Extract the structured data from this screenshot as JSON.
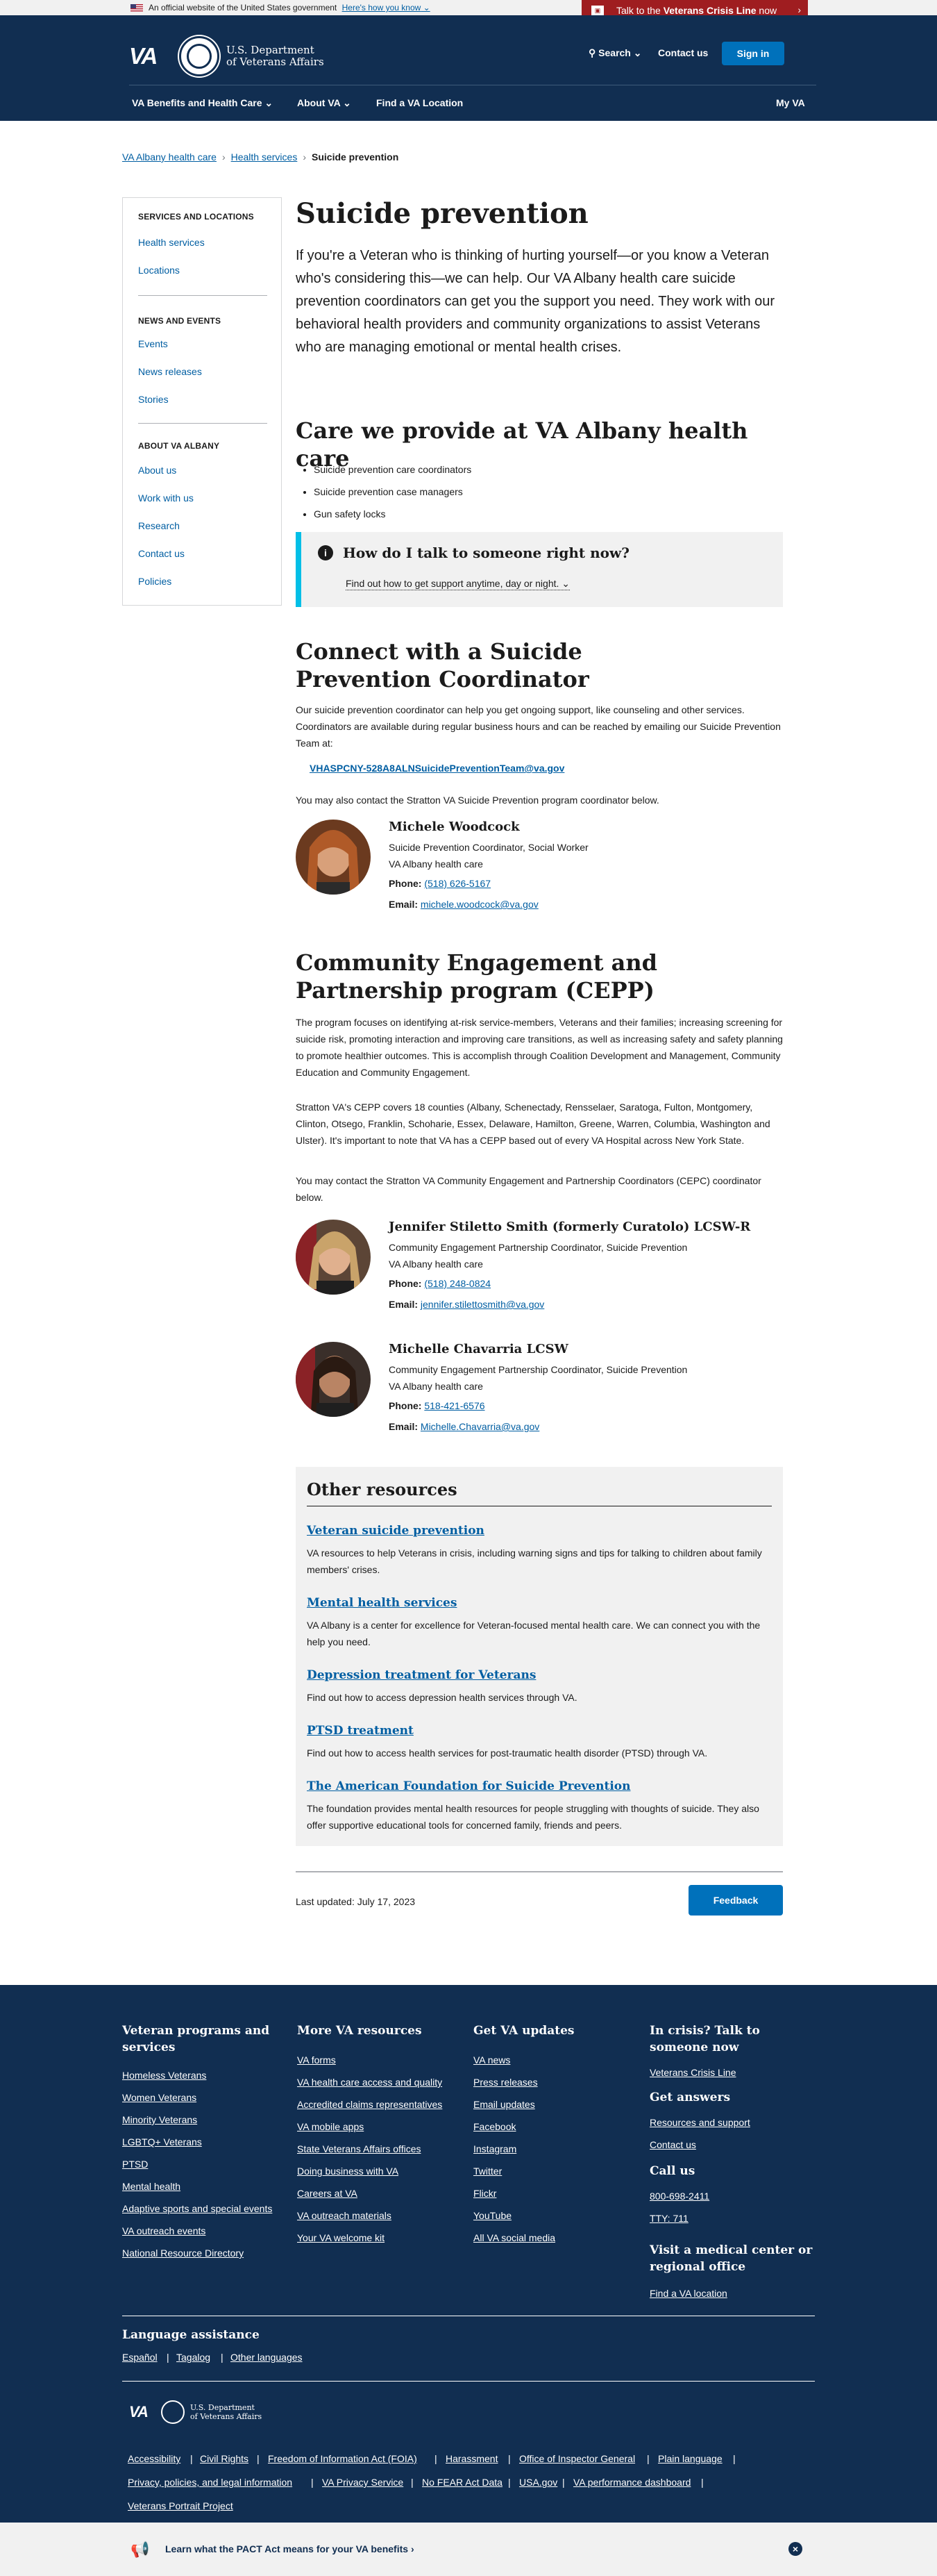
{
  "gov_banner": {
    "text": "An official website of the United States government",
    "link": "Here's how you know"
  },
  "crisis_line": {
    "prefix": "Talk to the ",
    "bold": "Veterans Crisis Line",
    "suffix": " now"
  },
  "header": {
    "logo_va": "VA",
    "logo_line1": "U.S. Department",
    "logo_line2": "of Veterans Affairs",
    "search": "Search",
    "contact": "Contact us",
    "signin": "Sign in",
    "nav": [
      "VA Benefits and Health Care",
      "About VA",
      "Find a VA Location"
    ],
    "myva": "My VA"
  },
  "breadcrumbs": [
    "VA Albany health care",
    "Health services",
    "Suicide prevention"
  ],
  "sidenav": {
    "sections": [
      {
        "title": "SERVICES AND LOCATIONS",
        "links": [
          "Health services",
          "Locations"
        ]
      },
      {
        "title": "NEWS AND EVENTS",
        "links": [
          "Events",
          "News releases",
          "Stories"
        ]
      },
      {
        "title": "ABOUT VA ALBANY",
        "links": [
          "About us",
          "Work with us",
          "Research",
          "Contact us",
          "Policies"
        ]
      }
    ]
  },
  "main": {
    "title": "Suicide prevention",
    "intro": "If you're a Veteran who is thinking of hurting yourself—or you know a Veteran who's considering this—we can help. Our VA Albany health care suicide prevention coordinators can get you the support you need. They work with our behavioral health providers and community organizations to assist Veterans who are managing emotional or mental health crises.",
    "care_heading": "Care we provide at VA Albany health care",
    "care_items": [
      "Suicide prevention care coordinators",
      "Suicide prevention case managers",
      "Gun safety locks"
    ],
    "alert_heading": "How do I talk to someone right now?",
    "alert_link": "Find out how to get support anytime, day or night.",
    "coord_heading": "Connect with a Suicide Prevention Coordinator",
    "coord_text": "Our suicide prevention coordinator can help you get ongoing support, like counseling and other services. Coordinators are available during regular business hours and can be reached by emailing our Suicide Prevention Team at:",
    "team_email": "VHASPCNY-528A8ALNSuicidePreventionTeam@va.gov",
    "contact_text": "You may also contact the Stratton VA Suicide Prevention program coordinator below.",
    "people": [
      {
        "name": "Michele Woodcock",
        "role": "Suicide Prevention Coordinator, Social Worker",
        "org": "VA Albany health care",
        "phone_label": "Phone:",
        "phone": "(518) 626-5167",
        "email_label": "Email:",
        "email": "michele.woodcock@va.gov"
      },
      {
        "name": "Jennifer Stiletto Smith (formerly Curatolo) LCSW-R",
        "role": "Community Engagement Partnership Coordinator, Suicide Prevention",
        "org": "VA Albany health care",
        "phone_label": "Phone:",
        "phone": "(518) 248-0824",
        "email_label": "Email:",
        "email": "jennifer.stilettosmith@va.gov"
      },
      {
        "name": "Michelle Chavarria LCSW",
        "role": "Community Engagement Partnership Coordinator, Suicide Prevention",
        "org": "VA Albany health care",
        "phone_label": "Phone:",
        "phone": "518-421-6576",
        "email_label": "Email:",
        "email": "Michelle.Chavarria@va.gov"
      }
    ],
    "cepp_heading": "Community Engagement and Partnership program (CEPP)",
    "cepp_p1": "The program focuses on identifying at-risk service-members, Veterans and their families; increasing screening for suicide risk, promoting interaction and improving care transitions, as well as increasing safety and safety planning to promote healthier outcomes.  This is accomplish through Coalition Development and Management, Community Education and Community Engagement.",
    "cepp_p2": "Stratton VA's CEPP  covers 18 counties (Albany, Schenectady, Rensselaer, Saratoga, Fulton, Montgomery, Clinton, Otsego, Franklin, Schoharie, Essex, Delaware, Hamilton, Greene, Warren, Columbia, Washington and Ulster).  It's important to note that VA has a CEPP based out of every VA Hospital across New York State.",
    "cepp_p3": "You may contact the Stratton VA Community Engagement and Partnership Coordinators (CEPC) coordinator below.",
    "resources_heading": "Other resources",
    "resources": [
      {
        "title": "Veteran suicide prevention",
        "desc": "VA resources to help Veterans in crisis, including warning signs and tips for talking to children about family members' crises."
      },
      {
        "title": "Mental health services",
        "desc": "VA Albany is a center for excellence for Veteran-focused mental health care. We can connect you with the help you need."
      },
      {
        "title": "Depression treatment for Veterans",
        "desc": "Find out how to access depression health services through VA."
      },
      {
        "title": "PTSD treatment",
        "desc": "Find out how to access health services for post-traumatic health disorder (PTSD) through VA."
      },
      {
        "title": "The American Foundation for Suicide Prevention",
        "desc": "The foundation provides mental health resources for people struggling with thoughts of suicide. They also offer supportive educational tools for concerned family, friends and peers."
      }
    ],
    "last_updated": "Last updated: July 17, 2023",
    "feedback": "Feedback"
  },
  "footer": {
    "col1_heading": "Veteran programs and services",
    "col1_links": [
      "Homeless Veterans",
      "Women Veterans",
      "Minority Veterans",
      "LGBTQ+ Veterans",
      "PTSD",
      "Mental health",
      "Adaptive sports and special events",
      "VA outreach events",
      "National Resource Directory"
    ],
    "col2_heading": "More VA resources",
    "col2_links": [
      "VA forms",
      "VA health care access and quality",
      "Accredited claims representatives",
      "VA mobile apps",
      "State Veterans Affairs offices",
      "Doing business with VA",
      "Careers at VA",
      "VA outreach materials",
      "Your VA welcome kit"
    ],
    "col3_heading": "Get VA updates",
    "col3_links": [
      "VA news",
      "Press releases",
      "Email updates",
      "Facebook",
      "Instagram",
      "Twitter",
      "Flickr",
      "YouTube",
      "All VA social media"
    ],
    "crisis_heading": "In crisis? Talk to someone now",
    "crisis_link": "Veterans Crisis Line",
    "answers_heading": "Get answers",
    "answers_links": [
      "Resources and support",
      "Contact us"
    ],
    "call_heading": "Call us",
    "call_links": [
      "800-698-2411",
      "TTY: 711"
    ],
    "visit_heading": "Visit a medical center or regional office",
    "visit_link": "Find a VA location",
    "lang_heading": "Language assistance",
    "langs": [
      "Español",
      "Tagalog",
      "Other languages"
    ],
    "logo_va": "VA",
    "logo_line1": "U.S. Department",
    "logo_line2": "of Veterans Affairs",
    "bottom_links_row1": [
      "Accessibility",
      "Civil Rights",
      "Freedom of Information Act (FOIA)",
      "Harassment",
      "Office of Inspector General",
      "Plain language"
    ],
    "bottom_links_row2": [
      "Privacy, policies, and legal information",
      "VA Privacy Service",
      "No FEAR Act Data",
      "USA.gov",
      "VA performance dashboard"
    ],
    "bottom_links_row3": [
      "Veterans Portrait Project"
    ]
  },
  "pact": {
    "text": "Learn what the PACT Act means for your VA benefits"
  },
  "colors": {
    "navy": "#112e51",
    "blue": "#0071bb",
    "link": "#005ea2",
    "crisis_red": "#9f1d20",
    "alert_border": "#02bfe7"
  }
}
